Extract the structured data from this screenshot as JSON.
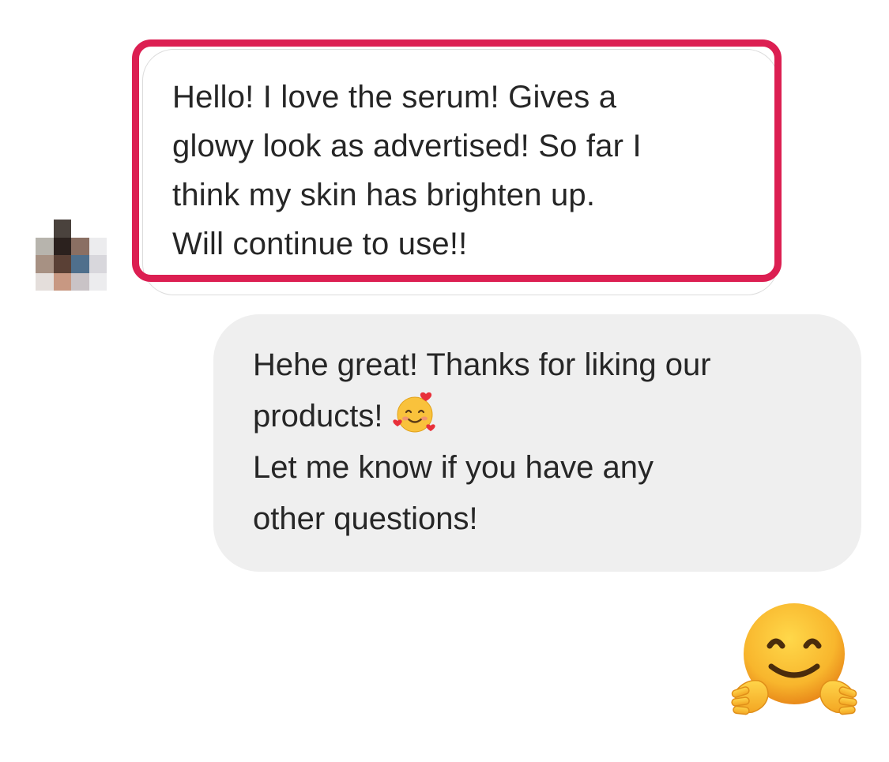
{
  "conversation": {
    "incoming": {
      "lines": [
        "Hello! I love the serum! Gives a",
        "glowy look as advertised! So far I",
        "think my skin has brighten up.",
        "Will continue to use!!"
      ],
      "highlight_color": "#dc1f52",
      "avatar": "pixelated-avatar"
    },
    "outgoing": {
      "lines": [
        "Hehe great! Thanks for liking our",
        "products!",
        "Let me know if you have any",
        "other questions!"
      ],
      "inline_emoji": "smiling-face-with-hearts-icon",
      "bubble_color": "#efefef"
    },
    "reaction": {
      "emoji": "hugging-face-icon"
    }
  }
}
